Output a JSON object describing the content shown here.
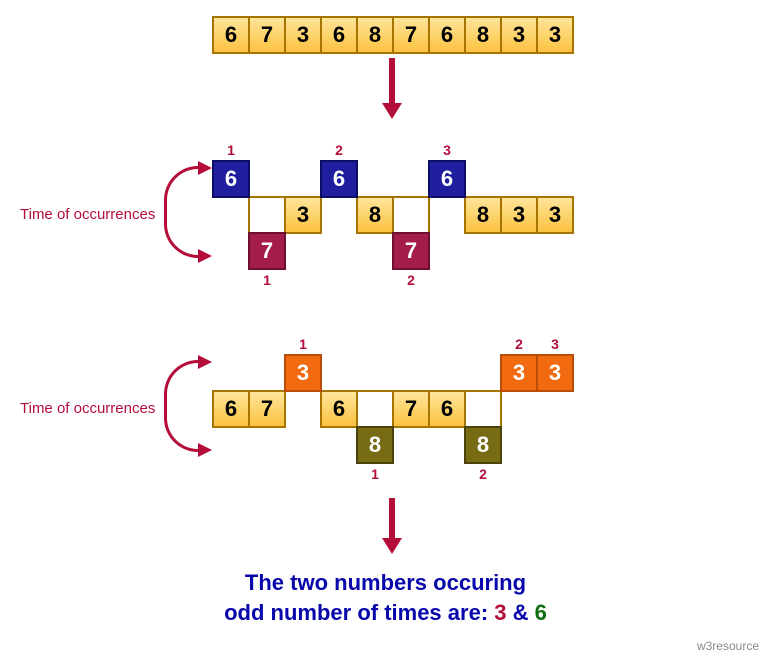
{
  "array": [
    "6",
    "7",
    "3",
    "6",
    "8",
    "7",
    "6",
    "8",
    "3",
    "3"
  ],
  "arrow1": {
    "shaft": 45,
    "total": 61
  },
  "occLabel": "Time of occurrences",
  "group1": {
    "row": [
      {
        "v": "6",
        "cls": "blue lift"
      },
      {
        "v": "",
        "cls": "white"
      },
      {
        "v": "3",
        "cls": "yellow"
      },
      {
        "v": "6",
        "cls": "blue lift"
      },
      {
        "v": "8",
        "cls": "yellow"
      },
      {
        "v": "",
        "cls": "white"
      },
      {
        "v": "6",
        "cls": "blue lift"
      },
      {
        "v": "8",
        "cls": "yellow"
      },
      {
        "v": "3",
        "cls": "yellow"
      },
      {
        "v": "3",
        "cls": "yellow"
      }
    ],
    "low": [
      {
        "i": 1,
        "v": "7",
        "cls": "maroon"
      },
      {
        "i": 5,
        "v": "7",
        "cls": "maroon"
      }
    ],
    "topTags": [
      {
        "i": 0,
        "t": "1"
      },
      {
        "i": 3,
        "t": "2"
      },
      {
        "i": 6,
        "t": "3"
      }
    ],
    "botTags": [
      {
        "i": 1,
        "t": "1"
      },
      {
        "i": 5,
        "t": "2"
      }
    ]
  },
  "group2": {
    "row": [
      {
        "v": "6",
        "cls": "yellow"
      },
      {
        "v": "7",
        "cls": "yellow"
      },
      {
        "v": "3",
        "cls": "orange lift"
      },
      {
        "v": "6",
        "cls": "yellow"
      },
      {
        "v": "",
        "cls": "white"
      },
      {
        "v": "7",
        "cls": "yellow"
      },
      {
        "v": "6",
        "cls": "yellow"
      },
      {
        "v": "",
        "cls": "white"
      },
      {
        "v": "3",
        "cls": "orange lift"
      },
      {
        "v": "3",
        "cls": "orange lift"
      }
    ],
    "low": [
      {
        "i": 4,
        "v": "8",
        "cls": "olive"
      },
      {
        "i": 7,
        "v": "8",
        "cls": "olive"
      }
    ],
    "topTags": [
      {
        "i": 2,
        "t": "1"
      },
      {
        "i": 8,
        "t": "2"
      },
      {
        "i": 9,
        "t": "3"
      }
    ],
    "botTags": [
      {
        "i": 4,
        "t": "1"
      },
      {
        "i": 7,
        "t": "2"
      }
    ]
  },
  "arrow2": {
    "shaft": 40,
    "total": 56
  },
  "result": {
    "line1": "The two numbers occuring",
    "line2a": "odd number of times are: ",
    "n1": "3",
    "amp": " & ",
    "n2": "6"
  },
  "attrib": "w3resource"
}
